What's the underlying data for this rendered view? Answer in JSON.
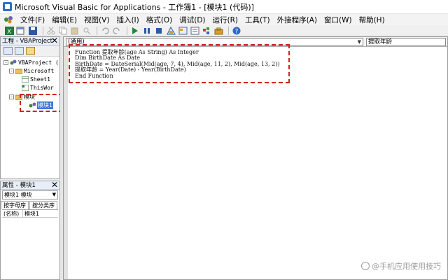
{
  "window": {
    "title": "Microsoft Visual Basic for Applications - 工作簿1 - [模块1 (代码)]"
  },
  "menu": [
    "文件(F)",
    "编辑(E)",
    "视图(V)",
    "插入(I)",
    "格式(O)",
    "调试(D)",
    "运行(R)",
    "工具(T)",
    "外接程序(A)",
    "窗口(W)",
    "帮助(H)"
  ],
  "project_pane": {
    "title": "工程 - VBAProject",
    "close_glyph": "✕",
    "tree": {
      "root": "VBAProject (",
      "folder1": "Microsoft",
      "sheet": "Sheet1",
      "thisworkbook": "ThisWor",
      "folder2": "模块",
      "module": "模块1"
    },
    "toggles": [
      "-",
      "-",
      "-"
    ]
  },
  "properties_pane": {
    "title": "属性 - 模块1",
    "close_glyph": "✕",
    "object": "模块1 模块",
    "tabs": [
      "按字母序",
      "按分类序"
    ],
    "rows": [
      {
        "name": "(名称)",
        "value": "模块1"
      }
    ]
  },
  "code_window": {
    "object_combo": "(通用)",
    "proc_combo": "提取年龄",
    "lines": [
      "Function 提取年龄(age As String) As Integer",
      "Dim BirthDate As Date",
      "BirthDate = DateSerial(Mid(age, 7, 4), Mid(age, 11, 2), Mid(age, 13, 2))",
      "提取年龄 = Year(Date) - Year(BirthDate)",
      "End Function"
    ]
  },
  "watermark": "@手机应用使用技巧",
  "colors": {
    "highlight": "#d42020",
    "selection": "#3b78d8"
  },
  "icons": {
    "toolbar": [
      "excel-icon",
      "insert-module-icon",
      "save-icon",
      "cut-icon",
      "copy-icon",
      "paste-icon",
      "find-icon",
      "undo-icon",
      "redo-icon",
      "run-icon",
      "break-icon",
      "reset-icon",
      "design-mode-icon",
      "project-explorer-icon",
      "properties-icon",
      "object-browser-icon",
      "toolbox-icon",
      "help-icon"
    ]
  }
}
